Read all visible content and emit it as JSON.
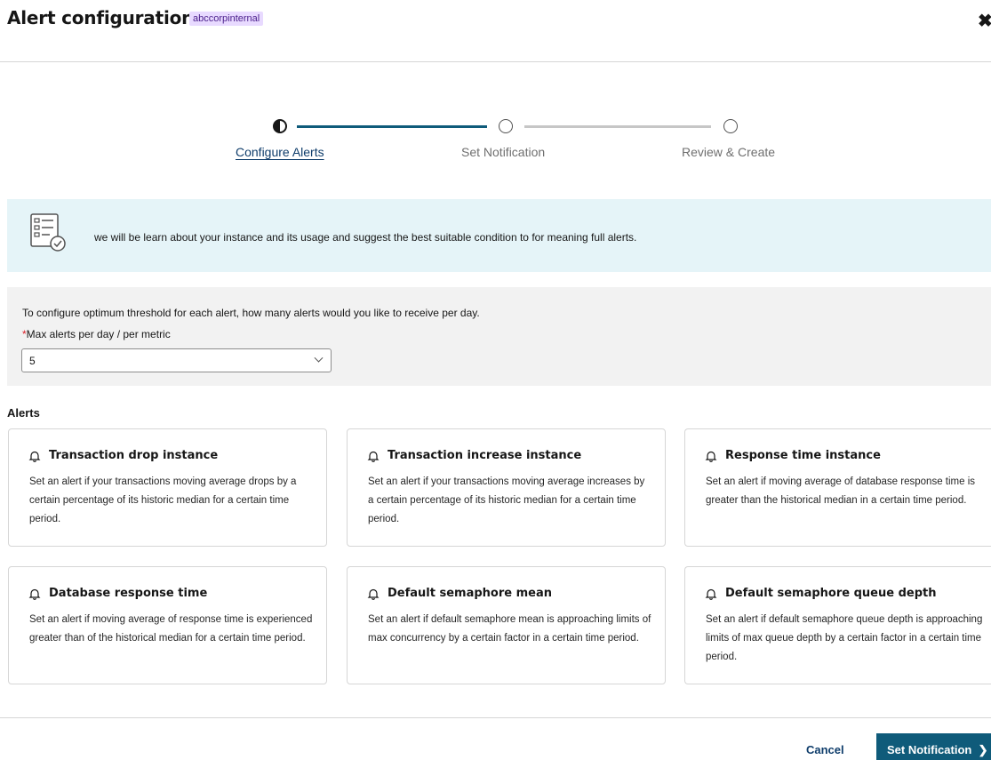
{
  "header": {
    "title": "Alert configuration",
    "tag": "abccorpinternal",
    "close_icon": "close-icon"
  },
  "stepper": {
    "steps": [
      {
        "label": "Configure Alerts",
        "state": "current"
      },
      {
        "label": "Set Notification",
        "state": "upcoming"
      },
      {
        "label": "Review & Create",
        "state": "upcoming"
      }
    ],
    "colors": {
      "active": "#0f5b7a",
      "inactive": "#c6c6c6"
    }
  },
  "banner": {
    "icon": "checklist-icon",
    "text": "we will be learn about  your instance and its usage and suggest the best suitable condition to for meaning full alerts."
  },
  "threshold": {
    "question": "To configure optimum threshold for each alert, how many alerts would you like to receive per day.",
    "required_mark": "*",
    "label": "Max alerts per day / per metric",
    "selected_value": "5"
  },
  "alerts": {
    "heading": "Alerts",
    "cards": [
      {
        "title": "Transaction drop instance",
        "description": "Set an alert if your transactions moving average drops by a certain percentage of its historic median for a certain time period."
      },
      {
        "title": "Transaction increase instance",
        "description": "Set an alert if your transactions moving average increases by a certain percentage of its historic median for a certain time period."
      },
      {
        "title": "Response time instance",
        "description": "Set an alert if moving average of database response time is greater than the historical median in a certain time period."
      },
      {
        "title": "Database response time",
        "description": "Set an alert if moving average of response time is experienced greater than of the historical median for a certain time period."
      },
      {
        "title": "Default semaphore mean",
        "description": "Set an alert if default semaphore mean is approaching limits of max concurrency by a certain factor in a certain time period."
      },
      {
        "title": "Default semaphore queue depth",
        "description": "Set an alert if default semaphore queue depth is approaching limits of max queue depth by a certain factor in a certain time period."
      }
    ]
  },
  "footer": {
    "cancel_label": "Cancel",
    "primary_label": "Set Notification",
    "primary_icon": "chevron-right-icon",
    "primary_color": "#0f5b7a"
  }
}
